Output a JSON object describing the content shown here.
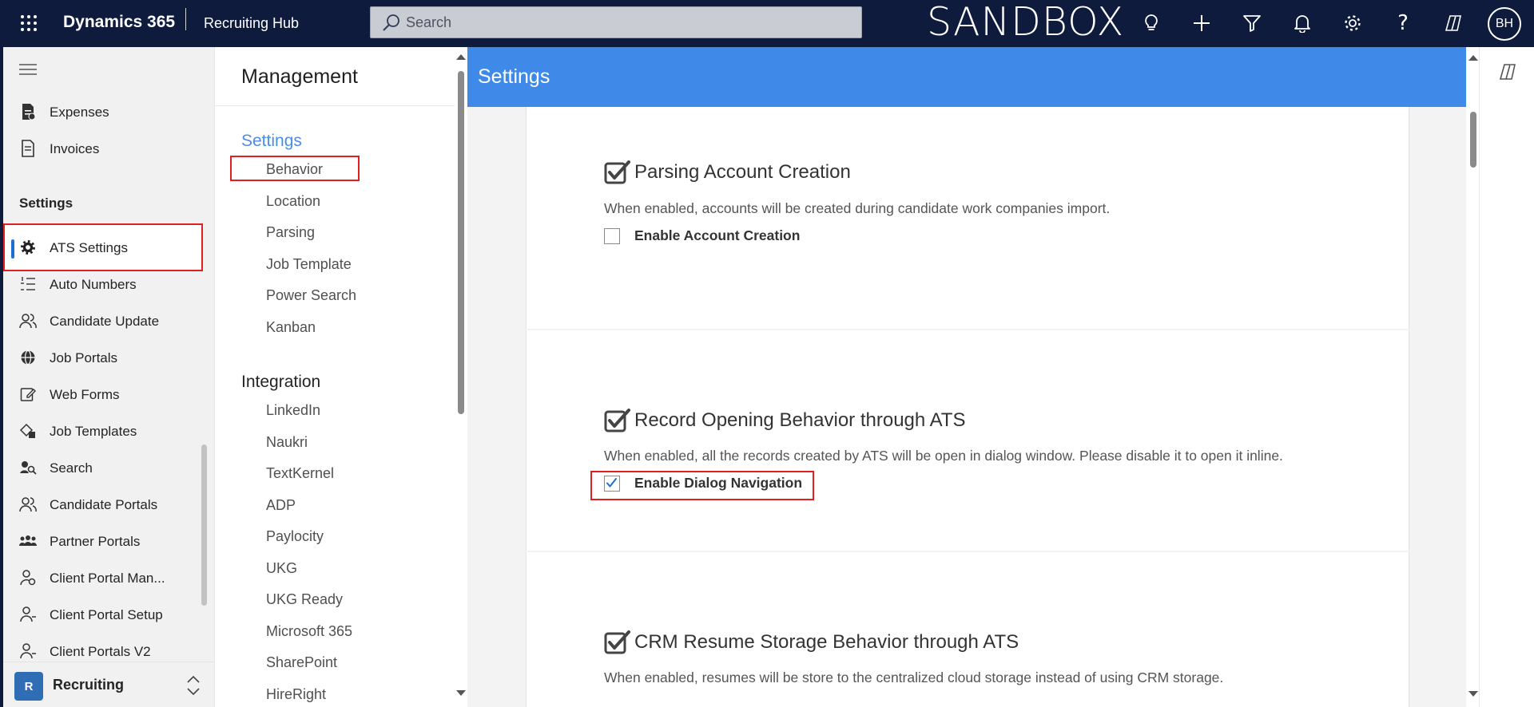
{
  "topbar": {
    "app_name": "Dynamics 365",
    "hub_name": "Recruiting Hub",
    "search_placeholder": "Search",
    "environment_label": "SANDBOX",
    "user_initials": "BH",
    "icons": [
      "lightbulb-icon",
      "plus-icon",
      "filter-icon",
      "bell-icon",
      "gear-icon",
      "help-icon",
      "copilot-icon"
    ]
  },
  "leftnav": {
    "items_top": [
      {
        "label": "Expenses",
        "icon": "expenses-icon"
      },
      {
        "label": "Invoices",
        "icon": "invoices-icon"
      }
    ],
    "settings_heading": "Settings",
    "items_settings": [
      {
        "label": "ATS Settings",
        "icon": "gear-icon",
        "selected": true
      },
      {
        "label": "Auto Numbers",
        "icon": "numbered-list-icon"
      },
      {
        "label": "Candidate Update",
        "icon": "people-icon"
      },
      {
        "label": "Job Portals",
        "icon": "globe-icon"
      },
      {
        "label": "Web Forms",
        "icon": "form-edit-icon"
      },
      {
        "label": "Job Templates",
        "icon": "template-icon"
      },
      {
        "label": "Search",
        "icon": "search-people-icon"
      },
      {
        "label": "Candidate Portals",
        "icon": "people-icon"
      },
      {
        "label": "Partner Portals",
        "icon": "group-icon"
      },
      {
        "label": "Client Portal Man...",
        "icon": "person-settings-icon"
      },
      {
        "label": "Client Portal Setup",
        "icon": "person-icon"
      },
      {
        "label": "Client Portals V2",
        "icon": "person-icon"
      }
    ],
    "area": {
      "badge": "R",
      "label": "Recruiting"
    }
  },
  "management": {
    "title": "Management",
    "settings_group": "Settings",
    "settings_links": [
      "Behavior",
      "Location",
      "Parsing",
      "Job Template",
      "Power Search",
      "Kanban"
    ],
    "integration_group": "Integration",
    "integration_links": [
      "LinkedIn",
      "Naukri",
      "TextKernel",
      "ADP",
      "Paylocity",
      "UKG",
      "UKG Ready",
      "Microsoft 365",
      "SharePoint",
      "HireRight"
    ]
  },
  "content": {
    "banner_title": "Settings",
    "sections": [
      {
        "title": "Parsing Account Creation",
        "description": "When enabled, accounts will be created during candidate work companies import.",
        "option_label": "Enable Account Creation",
        "option_checked": false
      },
      {
        "title": "Record Opening Behavior through ATS",
        "description": "When enabled, all the records created by ATS will be open in dialog window. Please disable it to open it inline.",
        "option_label": "Enable Dialog Navigation",
        "option_checked": true
      },
      {
        "title": "CRM Resume Storage Behavior through ATS",
        "description": "When enabled, resumes will be store to the centralized cloud storage instead of using CRM storage."
      }
    ]
  },
  "colors": {
    "topbar": "#0e1b3d",
    "banner": "#3f8ae8",
    "highlight_box": "#e02020",
    "selected_bar": "#1d6fd6",
    "link_blue": "#4a8de8"
  }
}
